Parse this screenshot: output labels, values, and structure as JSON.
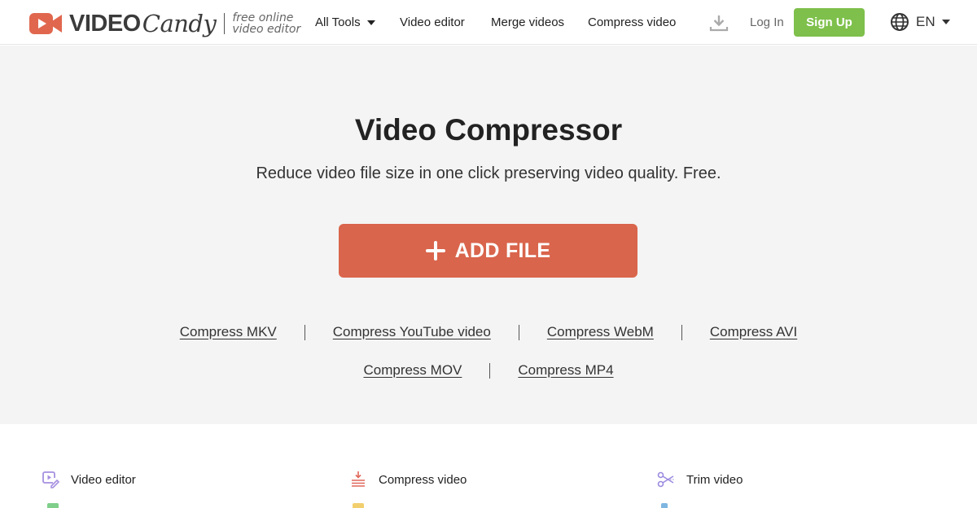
{
  "header": {
    "logo": {
      "word": "VIDEO",
      "script": "Candy",
      "tagline_line1": "free online",
      "tagline_line2": "video editor",
      "brand_color": "#e0674e"
    },
    "nav": [
      {
        "label": "All Tools",
        "has_dropdown": true
      },
      {
        "label": "Video editor"
      },
      {
        "label": "Merge videos"
      },
      {
        "label": "Compress video"
      }
    ],
    "download_icon": "download-icon",
    "login_label": "Log In",
    "signup_label": "Sign Up",
    "signup_color": "#7ec04b",
    "language": {
      "icon": "globe-icon",
      "selected": "EN"
    }
  },
  "hero": {
    "title": "Video Compressor",
    "subtitle": "Reduce video file size in one click preserving video quality. Free.",
    "add_file_label": "ADD FILE",
    "add_file_color": "#d9654c",
    "links_row1": [
      "Compress MKV",
      "Compress YouTube video",
      "Compress WebM",
      "Compress AVI"
    ],
    "links_row2": [
      "Compress MOV",
      "Compress MP4"
    ]
  },
  "tools": [
    {
      "label": "Video editor",
      "icon": "video-edit-icon",
      "color": "#a58fe0"
    },
    {
      "label": "Compress video",
      "icon": "compress-icon",
      "color": "#e0675a"
    },
    {
      "label": "Trim video",
      "icon": "scissors-icon",
      "color": "#9b8be0"
    }
  ]
}
